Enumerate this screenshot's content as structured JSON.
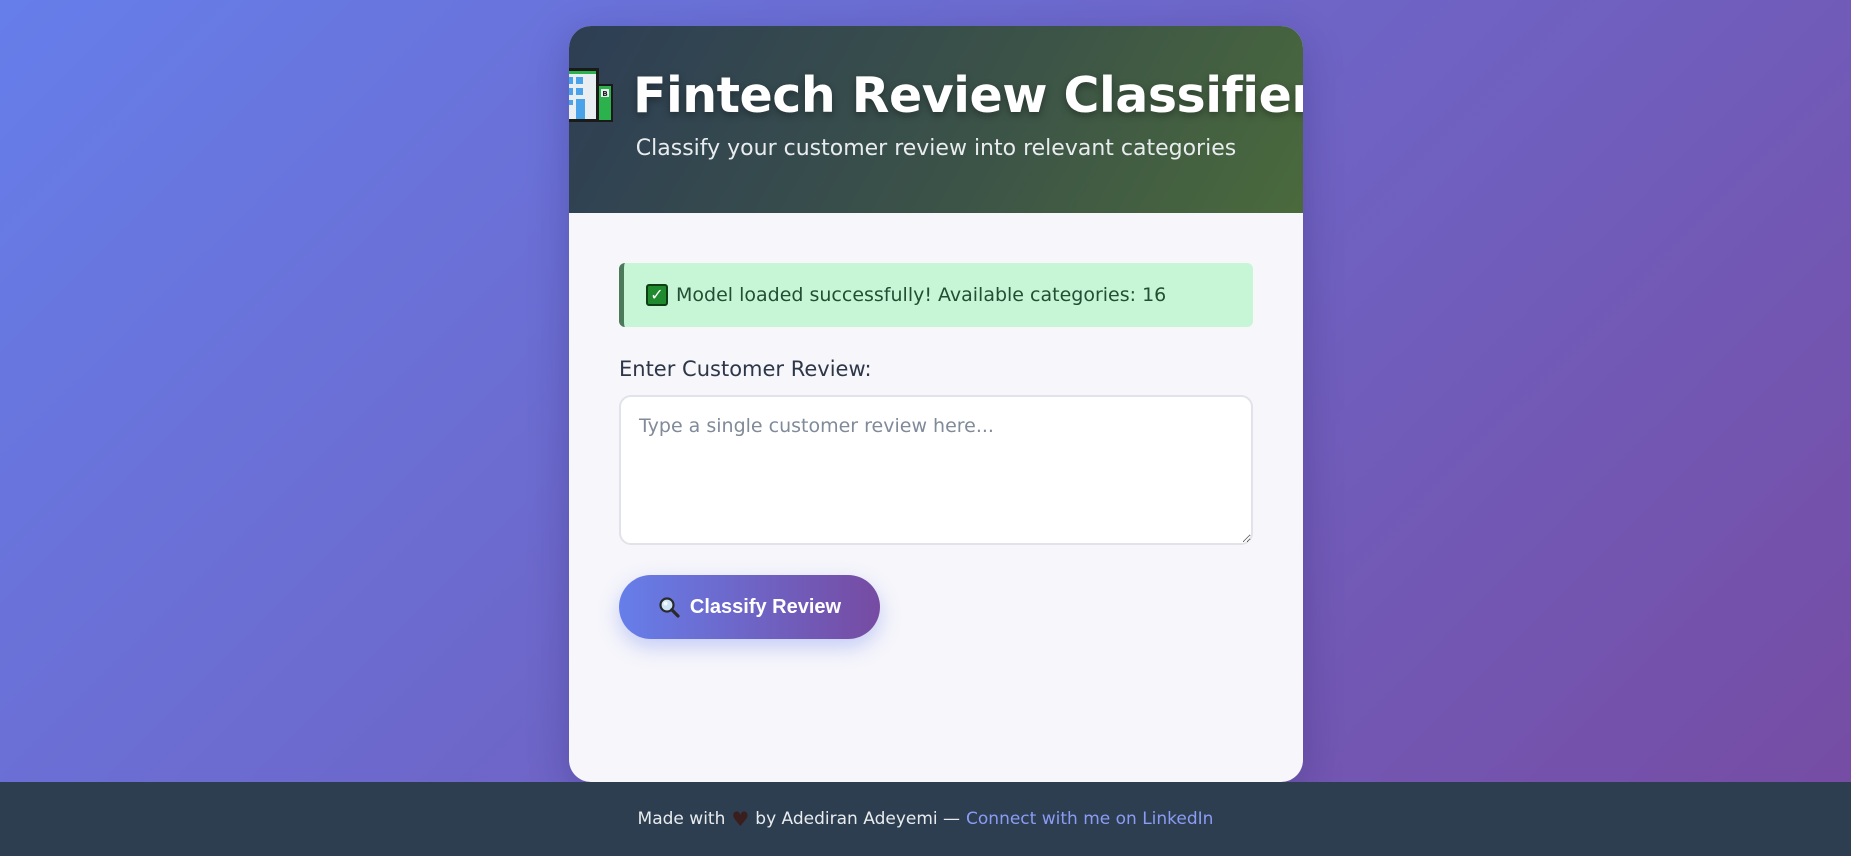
{
  "header": {
    "title": "Fintech Review Classifier",
    "subtitle": "Classify your customer review into relevant categories",
    "icon": "bank-building-icon"
  },
  "status": {
    "message": "Model loaded successfully! Available categories: 16",
    "icon": "check-mark-icon",
    "background": "#c6f6d5"
  },
  "form": {
    "label": "Enter Customer Review:",
    "value": "",
    "placeholder": "Type a single customer review here...",
    "button_label": "Classify Review",
    "button_icon": "magnifier-icon"
  },
  "footer": {
    "made_with": "Made with",
    "heart_icon": "heart-icon",
    "by": "by Adediran Adeyemi —",
    "link_text": "Connect with me on LinkedIn"
  },
  "colors": {
    "gradient_start": "#667eea",
    "gradient_end": "#764ba2",
    "footer_bg": "#2d3e50",
    "link": "#8a9cf5"
  }
}
